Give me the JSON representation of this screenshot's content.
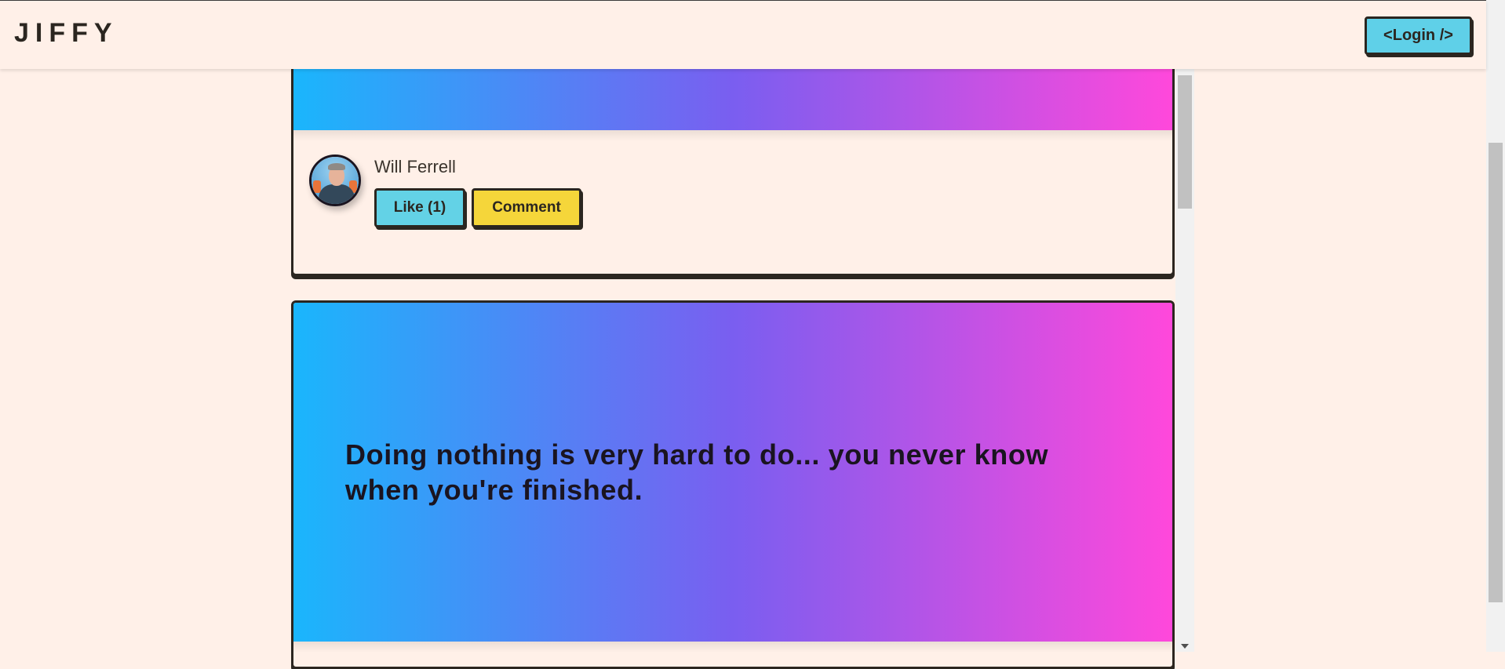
{
  "header": {
    "brand": "JIFFY",
    "login_label": "<Login />"
  },
  "posts": [
    {
      "author": "Will Ferrell",
      "like_label": "Like (1)",
      "comment_label": "Comment"
    },
    {
      "quote": "Doing nothing is very hard to do... you never know when you're finished."
    }
  ],
  "colors": {
    "background": "#fff0e8",
    "gradient_start": "#1ab6fc",
    "gradient_mid": "#7a5ef0",
    "gradient_end": "#ff48db",
    "like_button": "#63d2e6",
    "comment_button": "#f5d63a",
    "login_button": "#5fd0e8",
    "border": "#2b2620"
  }
}
